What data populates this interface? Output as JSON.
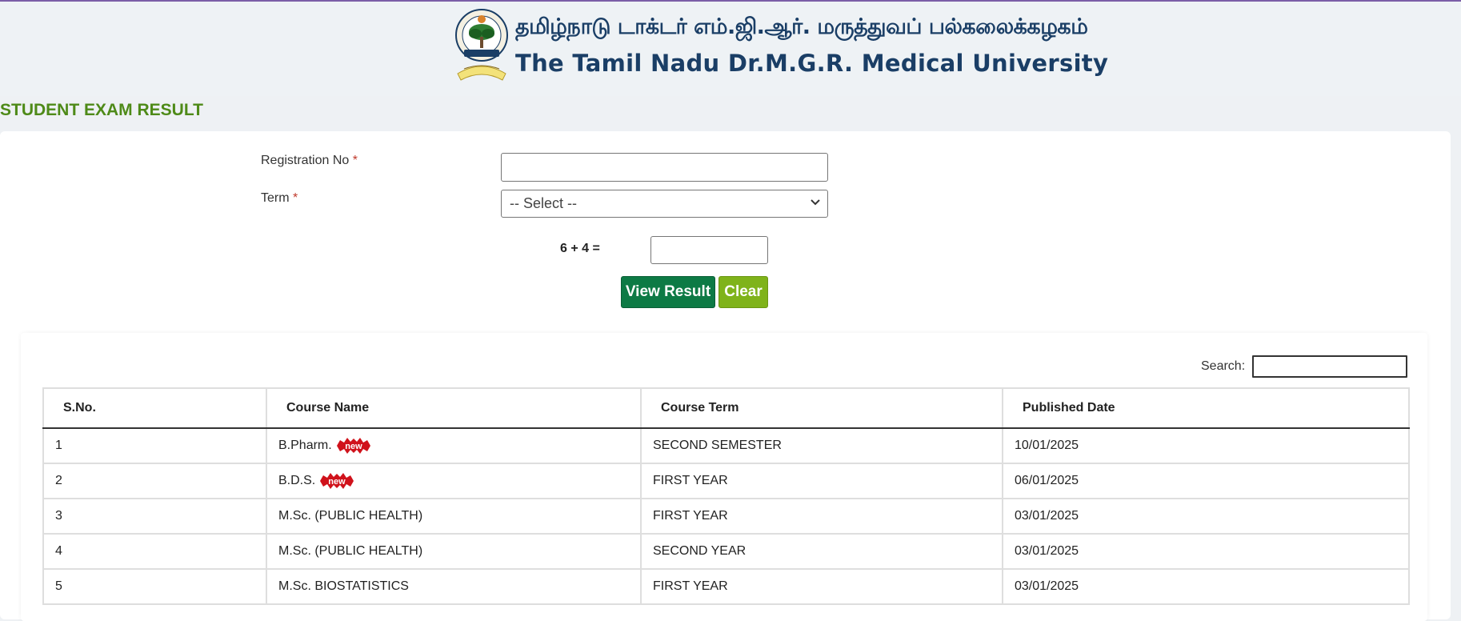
{
  "header": {
    "university_tamil": "தமிழ்நாடு டாக்டர் எம்.ஜி.ஆர். மருத்துவப் பல்கலைக்கழகம்",
    "university_english": "The Tamil Nadu Dr.M.G.R. Medical University",
    "logo_ribbon_text": "HEALTH FOR ALL"
  },
  "page_title": "STUDENT EXAM RESULT",
  "form": {
    "registration_label": "Registration No",
    "registration_value": "",
    "term_label": "Term",
    "required_mark": "*",
    "term_selected": "-- Select --",
    "captcha_question": "6 + 4 =",
    "captcha_value": "",
    "view_button": "View Result",
    "clear_button": "Clear"
  },
  "table": {
    "search_label": "Search:",
    "search_value": "",
    "columns": [
      "S.No.",
      "Course Name",
      "Course Term",
      "Published Date"
    ],
    "new_badge_text": "new",
    "rows": [
      {
        "sno": "1",
        "course": "B.Pharm.",
        "is_new": true,
        "term": "SECOND SEMESTER",
        "date": "10/01/2025"
      },
      {
        "sno": "2",
        "course": "B.D.S.",
        "is_new": true,
        "term": "FIRST YEAR",
        "date": "06/01/2025"
      },
      {
        "sno": "3",
        "course": "M.Sc. (PUBLIC HEALTH)",
        "is_new": false,
        "term": "FIRST YEAR",
        "date": "03/01/2025"
      },
      {
        "sno": "4",
        "course": "M.Sc. (PUBLIC HEALTH)",
        "is_new": false,
        "term": "SECOND YEAR",
        "date": "03/01/2025"
      },
      {
        "sno": "5",
        "course": "M.Sc. BIOSTATISTICS",
        "is_new": false,
        "term": "FIRST YEAR",
        "date": "03/01/2025"
      }
    ]
  },
  "colors": {
    "title_green": "#4e8a18",
    "view_button_bg": "#0d7a45",
    "clear_button_bg": "#7fb31a",
    "university_blue": "#1a3e66",
    "new_badge_red": "#d0121b"
  }
}
